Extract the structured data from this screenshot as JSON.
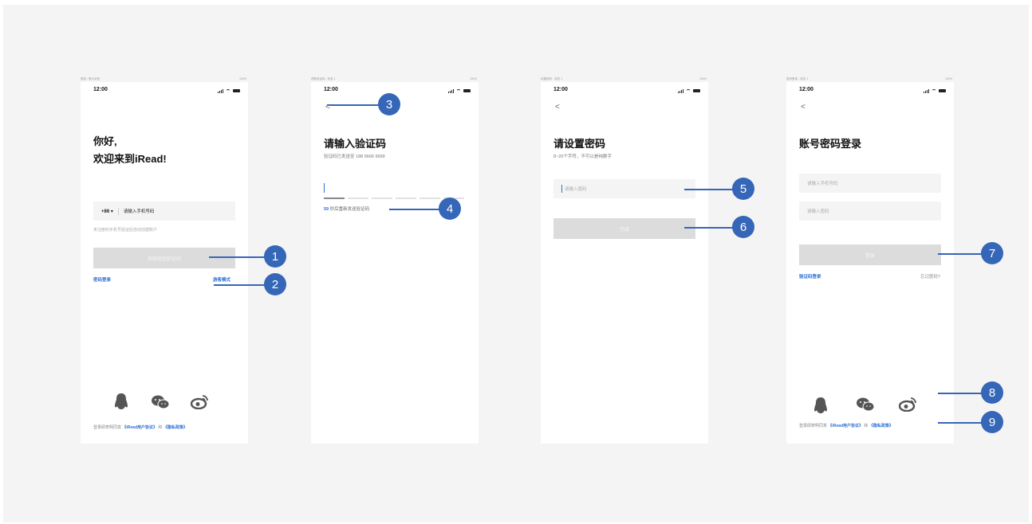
{
  "status_time": "12:00",
  "screens": [
    {
      "caption_left": "登录 - 默认状态",
      "caption_right": "100%",
      "greeting": "你好,",
      "welcome": "欢迎来到iRead!",
      "country_code": "+86 ▾",
      "phone_placeholder": "请输入手机号码",
      "hint": "未注册的手机号验证后自动创建账户",
      "button": "获取短信验证码",
      "password_login": "密码登录",
      "guest_mode": "游客模式",
      "agreement_prefix": "登录即表明同意",
      "agreement_user": "《iRead用户协议》",
      "agreement_and": "和",
      "agreement_privacy": "《隐私政策》"
    },
    {
      "caption_left": "获取验证码 - 状态 1",
      "caption_right": "100%",
      "back": "<",
      "title": "请输入验证码",
      "sent_to": "验证码已发送至 188 6666 9999",
      "countdown": "59",
      "resend": "秒后重新发送验证码"
    },
    {
      "caption_left": "设置密码 - 状态 1",
      "caption_right": "100%",
      "back": "<",
      "title": "请设置密码",
      "rule": "8~20个字符，不可以是纯数字",
      "password_placeholder": "请输入密码",
      "button": "完成"
    },
    {
      "caption_left": "密码登录 - 状态 1",
      "caption_right": "100%",
      "back": "<",
      "title": "账号密码登录",
      "phone_placeholder": "请输入手机号码",
      "password_placeholder": "请输入密码",
      "button": "登录",
      "code_login": "验证码登录",
      "forgot": "忘记密码?",
      "agreement_prefix": "登录即表明同意",
      "agreement_user": "《iRead用户协议》",
      "agreement_and": "和",
      "agreement_privacy": "《隐私政策》"
    }
  ],
  "callouts": [
    "1",
    "2",
    "3",
    "4",
    "5",
    "6",
    "7",
    "8",
    "9"
  ],
  "social_icons": [
    "qq-icon",
    "wechat-icon",
    "weibo-icon"
  ],
  "colors": {
    "accent": "#2c6fd6",
    "callout": "#3566b8",
    "board": "#f4f4f4",
    "disabled_button": "#dcdcdc"
  }
}
